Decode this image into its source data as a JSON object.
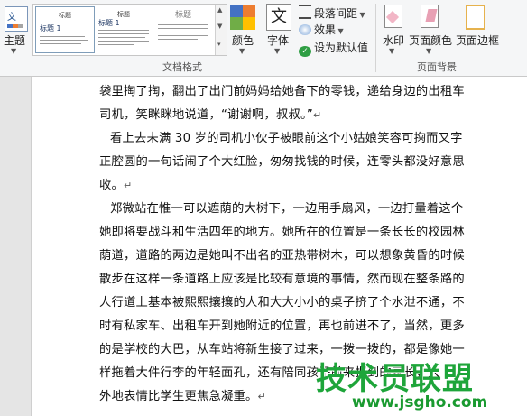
{
  "ribbon": {
    "theme_label": "主题",
    "theme_icon_text": "文",
    "style_thumbs": [
      {
        "title": "标题",
        "heading": "标题 1"
      },
      {
        "title": "标题",
        "heading": "标题 1"
      },
      {
        "title": "标题",
        "heading": ""
      }
    ],
    "colors_label": "颜色",
    "fonts_label": "字体",
    "fonts_icon_text": "文",
    "paragraph_spacing": "段落间距",
    "effects": "效果",
    "set_default": "设为默认值",
    "watermark": "水印",
    "page_color": "页面颜色",
    "page_border": "页面边框",
    "group_doc_format": "文档格式",
    "group_page_bg": "页面背景",
    "accent_colors": [
      "#4472c4",
      "#ed7d31",
      "#70ad47",
      "#ffc000"
    ]
  },
  "document": {
    "lines": [
      "袋里掏了掏，翻出了出门前妈妈给她备下的零钱，递给身边的出租车",
      "司机，笑眯眯地说道，“谢谢啊，叔叔。”",
      "看上去未满 30 岁的司机小伙子被眼前这个小姑娘笑容可掬而又字",
      "正腔圆的一句话闹了个大红脸，匆匆找钱的时候，连零头都没好意思",
      "收。",
      "郑微站在惟一可以遮荫的大树下，一边用手扇风，一边打量着这个",
      "她即将要战斗和生活四年的地方。她所在的位置是一条长长的校园林",
      "荫道，道路的两边是她叫不出名的亚热带树木，可以想象黄昏的时候",
      "散步在这样一条道路上应该是比较有意境的事情，然而现在整条路的",
      "人行道上基本被熙熙攘攘的人和大大小小的桌子挤了个水泄不通，不",
      "时有私家车、出租车开到她附近的位置，再也前进不了，当然，更多",
      "的是学校的大巴，从车站将新生接了过来，一拨一拨的，都是像她一",
      "样拖着大件行李的年轻面孔，还有陪同孩子前来报到的家长，大",
      "外地表情比学生更焦急凝重。"
    ],
    "para_mark": "↵"
  },
  "watermark_overlay": {
    "text": "技术员联盟",
    "url": "www.jsgho.com"
  }
}
